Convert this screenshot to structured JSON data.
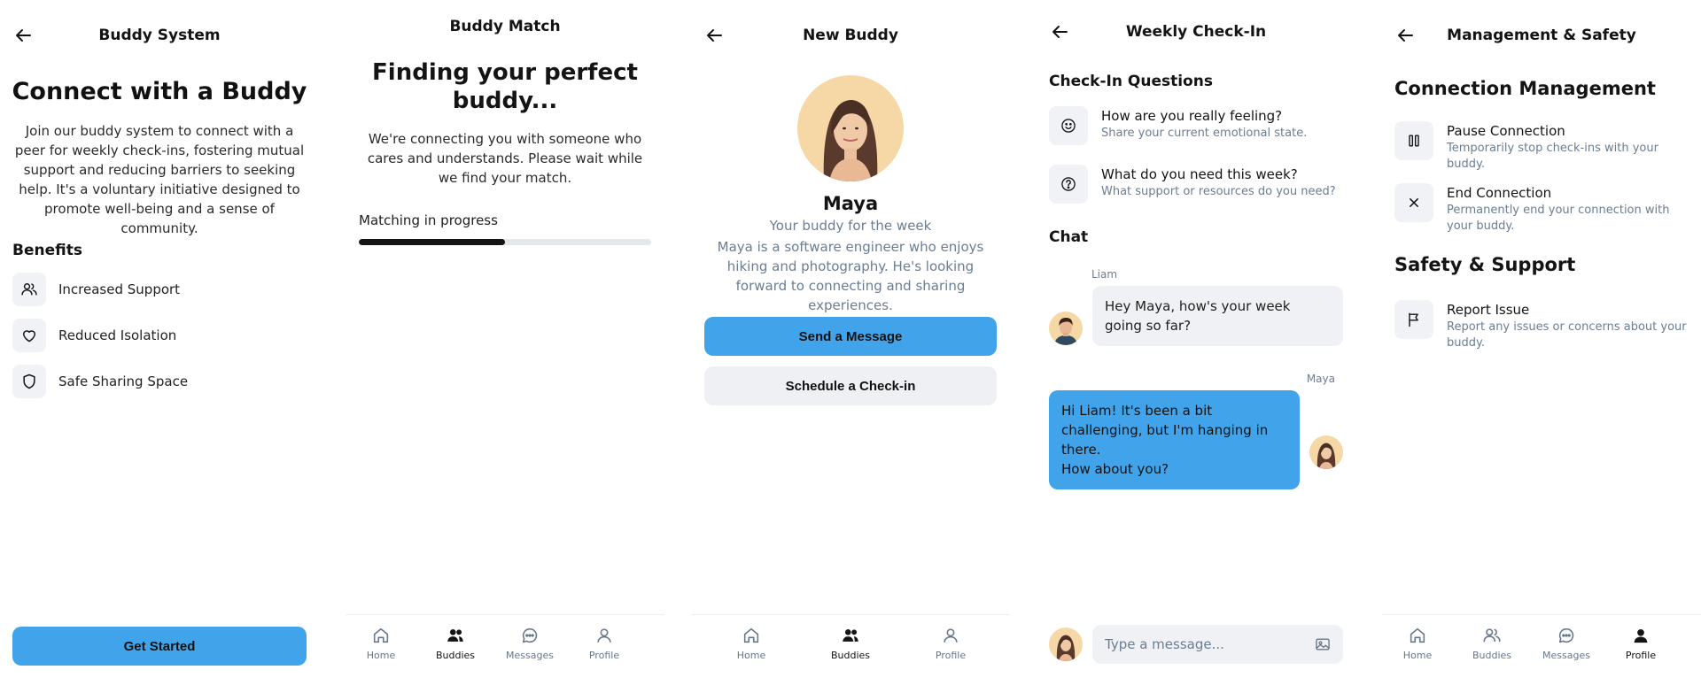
{
  "screen1": {
    "title": "Buddy System",
    "heading": "Connect with a Buddy",
    "description": "Join our buddy system to connect with a peer for weekly check-ins, fostering mutual support and reducing barriers to seeking help. It's a voluntary initiative designed to promote well-being and a sense of community.",
    "benefits_title": "Benefits",
    "benefits": [
      {
        "label": "Increased Support",
        "icon": "users-icon"
      },
      {
        "label": "Reduced Isolation",
        "icon": "heart-icon"
      },
      {
        "label": "Safe Sharing Space",
        "icon": "shield-icon"
      }
    ],
    "cta": "Get Started"
  },
  "screen2": {
    "title": "Buddy Match",
    "heading": "Finding your perfect buddy...",
    "description": "We're connecting you with someone who cares and understands. Please wait while we find your match.",
    "progress_label": "Matching in progress",
    "progress": 0.5
  },
  "screen3": {
    "title": "New Buddy",
    "name": "Maya",
    "subtitle": "Your buddy for the week",
    "bio": "Maya is a software engineer who enjoys hiking and photography. He's looking forward to connecting and sharing experiences.",
    "primary_btn": "Send a Message",
    "secondary_btn": "Schedule a Check-in"
  },
  "screen4": {
    "title": "Weekly Check-In",
    "questions_title": "Check-In Questions",
    "questions": [
      {
        "title": "How are you really feeling?",
        "sub": "Share your current emotional state.",
        "icon": "smile-icon"
      },
      {
        "title": "What do you need this week?",
        "sub": "What support or resources do you need?",
        "icon": "help-icon"
      }
    ],
    "chat_title": "Chat",
    "messages": [
      {
        "sender": "Liam",
        "text": "Hey Maya, how's your week going so far?"
      },
      {
        "sender": "Maya",
        "text": "Hi Liam! It's been a bit challenging, but I'm hanging in there.\nHow about you?"
      }
    ],
    "input_placeholder": "Type a message..."
  },
  "screen5": {
    "title": "Management & Safety",
    "section1": "Connection Management",
    "items1": [
      {
        "title": "Pause Connection",
        "sub": "Temporarily stop check-ins with your buddy.",
        "icon": "pause-icon"
      },
      {
        "title": "End Connection",
        "sub": "Permanently end your connection with your buddy.",
        "icon": "close-icon"
      }
    ],
    "section2": "Safety & Support",
    "items2": [
      {
        "title": "Report Issue",
        "sub": "Report any issues or concerns about your buddy.",
        "icon": "flag-icon"
      }
    ]
  },
  "nav4": {
    "home": "Home",
    "buddies": "Buddies",
    "messages": "Messages",
    "profile": "Profile"
  },
  "nav3": {
    "home": "Home",
    "buddies": "Buddies",
    "profile": "Profile"
  },
  "colors": {
    "primary": "#41a4ea",
    "secondary": "#eff0f3",
    "muted_text": "#6b7d92",
    "avatar_bg": "#f6d7a6"
  }
}
